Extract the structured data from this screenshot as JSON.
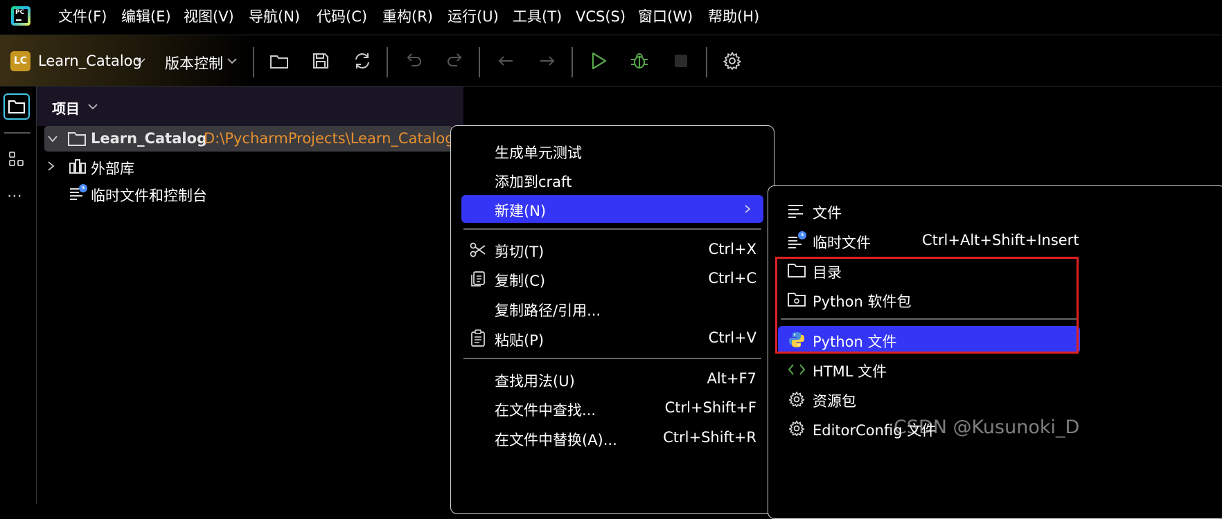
{
  "menubar": {
    "items": [
      "文件(F)",
      "编辑(E)",
      "视图(V)",
      "导航(N)",
      "代码(C)",
      "重构(R)",
      "运行(U)",
      "工具(T)",
      "VCS(S)",
      "窗口(W)",
      "帮助(H)"
    ]
  },
  "toolbar": {
    "project_badge": "LC",
    "project_name": "Learn_Catalog",
    "vcs_label": "版本控制"
  },
  "project_panel": {
    "header": "项目",
    "root_name": "Learn_Catalog",
    "root_path": "D:\\PycharmProjects\\Learn_Catalog",
    "external_libs": "外部库",
    "scratches": "临时文件和控制台"
  },
  "context_menu": {
    "gen_tests": "生成单元测试",
    "add_craft": "添加到craft",
    "new": "新建(N)",
    "cut": "剪切(T)",
    "cut_short": "Ctrl+X",
    "copy": "复制(C)",
    "copy_short": "Ctrl+C",
    "copy_path": "复制路径/引用...",
    "paste": "粘贴(P)",
    "paste_short": "Ctrl+V",
    "find_usages": "查找用法(U)",
    "find_usages_short": "Alt+F7",
    "find_in_files": "在文件中查找...",
    "find_in_files_short": "Ctrl+Shift+F",
    "replace_in_files": "在文件中替换(A)...",
    "replace_in_files_short": "Ctrl+Shift+R"
  },
  "submenu": {
    "file": "文件",
    "scratch": "临时文件",
    "scratch_short": "Ctrl+Alt+Shift+Insert",
    "directory": "目录",
    "python_package": "Python 软件包",
    "python_file": "Python 文件",
    "html_file": "HTML 文件",
    "resource_bundle": "资源包",
    "editorconfig": "EditorConfig 文件"
  },
  "watermark": "CSDN @Kusunoki_D",
  "colors": {
    "highlight": "#3535f5",
    "path_orange": "#e8902d",
    "run_green": "#57a64a",
    "red_box": "#e02020"
  }
}
